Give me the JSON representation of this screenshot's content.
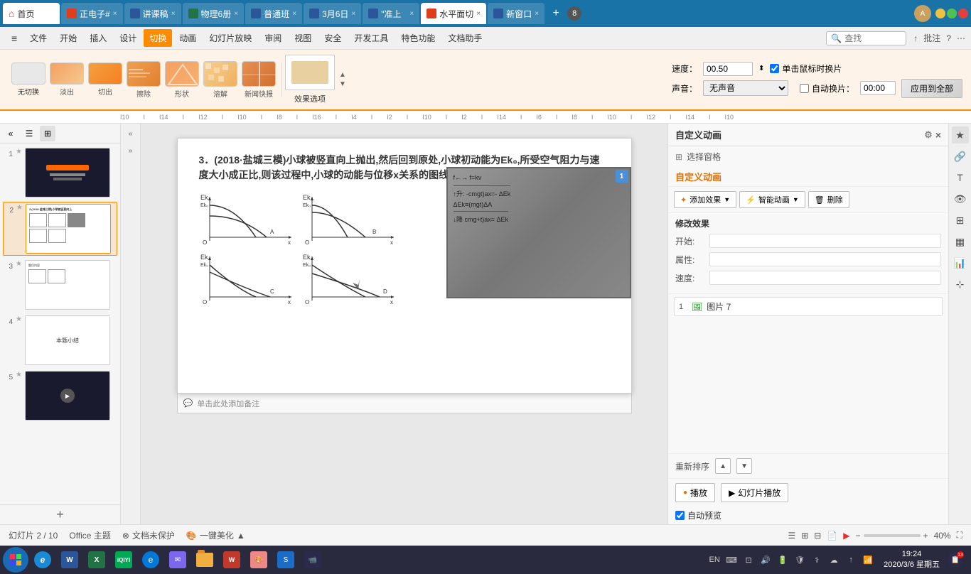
{
  "app": {
    "title": "水平面切换"
  },
  "tabs": [
    {
      "id": "home",
      "label": "首页",
      "icon": "red",
      "active": true
    },
    {
      "id": "ppt1",
      "label": "正电子#",
      "icon": "red",
      "close": true
    },
    {
      "id": "word1",
      "label": "讲课稿",
      "icon": "blue",
      "close": true
    },
    {
      "id": "excel1",
      "label": "物理6册",
      "icon": "green",
      "close": true
    },
    {
      "id": "word2",
      "label": "普通班",
      "icon": "blue",
      "close": true
    },
    {
      "id": "word3",
      "label": "3月6日",
      "icon": "blue",
      "close": true
    },
    {
      "id": "word4",
      "label": "\"准上",
      "icon": "blue",
      "close": true
    },
    {
      "id": "ppt2",
      "label": "水平面切",
      "icon": "red",
      "close": true,
      "active_tab": true
    },
    {
      "id": "word5",
      "label": "新窗口",
      "icon": "blue",
      "close": true
    }
  ],
  "menu": {
    "hamburger": "≡",
    "file": "文件",
    "start": "开始",
    "insert": "插入",
    "design": "设计",
    "switch": "切换",
    "animation": "动画",
    "slideshow": "幻灯片放映",
    "review": "审阅",
    "view": "视图",
    "safety": "安全",
    "devtools": "开发工具",
    "special": "特色功能",
    "docassist": "文档助手",
    "search_placeholder": "查找",
    "share": "分享",
    "comment": "批注",
    "help": "?",
    "more": "⋯"
  },
  "ribbon": {
    "transitions": [
      {
        "id": "none",
        "label": "无切换",
        "style": "none"
      },
      {
        "id": "fade",
        "label": "淡出",
        "style": "fade"
      },
      {
        "id": "cut",
        "label": "切出",
        "style": "cut"
      },
      {
        "id": "erase",
        "label": "擦除",
        "style": "erase"
      },
      {
        "id": "shape",
        "label": "形状",
        "style": "shape"
      },
      {
        "id": "dissolve",
        "label": "溶解",
        "style": "dissolve"
      },
      {
        "id": "news",
        "label": "新闻快报",
        "style": "news"
      }
    ],
    "speed_label": "速度：",
    "speed_value": "00.50",
    "check_click_switch": "单击鼠标时换片",
    "sound_label": "声音：",
    "sound_value": "无声音",
    "auto_switch_label": "自动换片：",
    "auto_switch_value": "00:00",
    "apply_all": "应用到全部",
    "effect_options": "效果选项",
    "scroll_up": "▲",
    "scroll_down": "▼"
  },
  "slides": [
    {
      "num": "1",
      "star": "★"
    },
    {
      "num": "2",
      "star": "★"
    },
    {
      "num": "3",
      "star": "★"
    },
    {
      "num": "4",
      "star": "★"
    },
    {
      "num": "5",
      "star": "★"
    }
  ],
  "slide_content": {
    "question_text": "3．(2018·盐城三模)小球被竖直向上抛出,然后回到原处,小球初动能为Ek₀,所受空气阻力与速度大小成正比,则该过程中,小球的动能与位移x关系的图线是下图中的（     ）",
    "badge_1": "1",
    "comment_placeholder": "单击此处添加备注"
  },
  "right_panel": {
    "title": "自定义动画",
    "select_window": "选择窗格",
    "custom_anim_label": "自定义动画",
    "add_effect": "添加效果",
    "smart_anim": "智能动画",
    "delete": "删除",
    "modify_title": "修改效果",
    "start_label": "开始:",
    "property_label": "属性:",
    "speed_label": "速度:",
    "reorder_label": "重新排序",
    "anim_items": [
      {
        "num": "1",
        "icon": "🖼",
        "label": "图片 7"
      }
    ],
    "play_label": "播放",
    "slideshow_label": "幻灯片播放",
    "auto_preview": "自动预览"
  },
  "status_bar": {
    "slide_info": "幻灯片 2 / 10",
    "theme": "Office 主题",
    "doc_protection": "文档未保护",
    "beautify": "一键美化",
    "zoom": "40%"
  },
  "taskbar": {
    "time": "19:24",
    "date": "2020/3/6 星期五",
    "notification_count": "13"
  }
}
